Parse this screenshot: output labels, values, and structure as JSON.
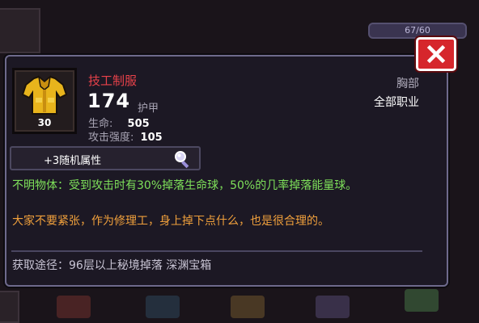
{
  "hud": {
    "bar_text": "67/60"
  },
  "tooltip": {
    "item_name": "技工制服",
    "item_level": "30",
    "armor_value": "174",
    "armor_label": "护甲",
    "stats": [
      {
        "label": "生命:",
        "value": "505"
      },
      {
        "label": "攻击强度:",
        "value": "105"
      }
    ],
    "slot_type": "胸部",
    "class_requirement": "全部职业",
    "random_attributes": "+3随机属性",
    "effect_text": "不明物体：受到攻击时有30%掉落生命球，50%的几率掉落能量球。",
    "flavor_text": "大家不要紧张，作为修理工，身上掉下点什么，也是很合理的。",
    "source_text": "获取途径：96层以上秘境掉落 深渊宝箱"
  },
  "colors": {
    "item_name": "#e8424a",
    "effect_text": "#7ee05a",
    "flavor_text": "#f0a03c",
    "close_button": "#d6262c"
  },
  "icons": {
    "item": "yellow-uniform-icon",
    "close": "close-icon",
    "inspect": "magnifier-icon"
  }
}
